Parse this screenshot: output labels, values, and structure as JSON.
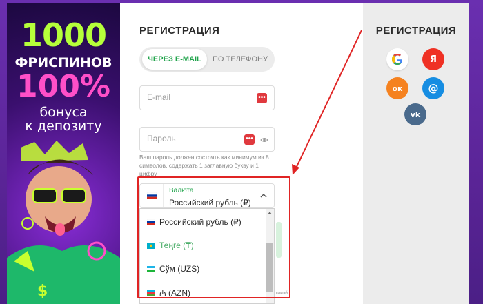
{
  "promo": {
    "line1": "1000",
    "line2": "ФРИСПИНОВ",
    "line3": "100%",
    "line4": "бонуса",
    "line5": "к депозиту"
  },
  "form": {
    "title": "РЕГИСТРАЦИЯ",
    "tabs": [
      {
        "label": "ЧЕРЕЗ E-MAIL",
        "active": true
      },
      {
        "label": "ПО ТЕЛЕФОНУ",
        "active": false
      }
    ],
    "email_placeholder": "E-mail",
    "password_placeholder": "Пароль",
    "password_hint": "Ваш пароль должен состоять как минимум из 8 символов, содержать 1 заглавную букву и 1 цифру",
    "currency": {
      "caption": "Валюта",
      "selected": "Российский рубль (₽)",
      "options": [
        {
          "label": "Российский рубль (₽)",
          "flag": "ru-flag-icon"
        },
        {
          "label": "Теңге (₸)",
          "flag": "kz-flag-icon"
        },
        {
          "label": "Сўм (UZS)",
          "flag": "uz-flag-icon"
        },
        {
          "label": "₼ (AZN)",
          "flag": "az-flag-icon"
        }
      ]
    },
    "peek_link": "тикой"
  },
  "social": {
    "title": "РЕГИСТРАЦИЯ",
    "buttons": [
      {
        "name": "google-icon",
        "glyph": "G",
        "color": "#ffffff",
        "fg": "#4285f4"
      },
      {
        "name": "yandex-icon",
        "glyph": "Я",
        "color": "#ef3124",
        "fg": "#ffffff"
      },
      {
        "name": "odnoklassniki-icon",
        "glyph": "ок",
        "color": "#f58220",
        "fg": "#ffffff"
      },
      {
        "name": "mail-icon",
        "glyph": "@",
        "color": "#168de2",
        "fg": "#ffffff"
      },
      {
        "name": "vk-icon",
        "glyph": "vk",
        "color": "#4a6a8c",
        "fg": "#ffffff"
      }
    ]
  },
  "colors": {
    "accent_green": "#1fa34a",
    "callout_red": "#e02424",
    "bg_purple": "#5a2496"
  }
}
